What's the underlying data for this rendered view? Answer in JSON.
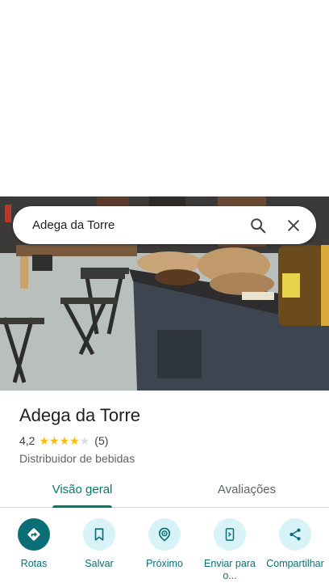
{
  "search": {
    "query": "Adega da Torre",
    "search_icon": "search-icon",
    "clear_icon": "close-icon"
  },
  "place": {
    "name": "Adega da Torre",
    "rating": "4,2",
    "rating_value": 4.2,
    "stars_max": 5,
    "review_count": "(5)",
    "category": "Distribuidor de bebidas"
  },
  "tabs": [
    {
      "label": "Visão geral",
      "active": true
    },
    {
      "label": "Avaliações",
      "active": false
    }
  ],
  "actions": [
    {
      "label": "Rotas",
      "icon": "directions-icon",
      "primary": true
    },
    {
      "label": "Salvar",
      "icon": "bookmark-icon",
      "primary": false
    },
    {
      "label": "Próximo",
      "icon": "nearby-icon",
      "primary": false
    },
    {
      "label": "Enviar para o...",
      "icon": "send-to-phone-icon",
      "primary": false
    },
    {
      "label": "Compartilhar",
      "icon": "share-icon",
      "primary": false
    }
  ],
  "colors": {
    "accent": "#00796b",
    "action_primary": "#0b6e76",
    "action_bg": "#d7f3f7",
    "star": "#fbbc04"
  }
}
